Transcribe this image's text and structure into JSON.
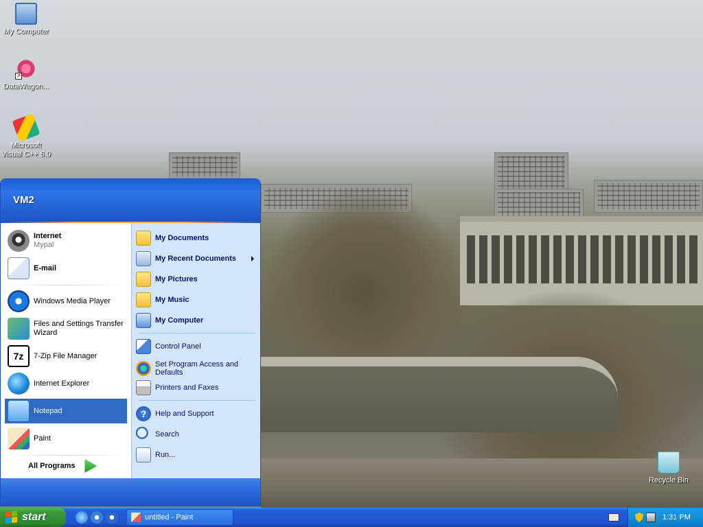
{
  "desktop": {
    "icons": [
      {
        "label": "My Computer"
      },
      {
        "label": "DataWagon..."
      },
      {
        "label": "Microsoft Visual C++ 6.0"
      },
      {
        "label": "Recycle Bin"
      }
    ]
  },
  "start_menu": {
    "user": "VM2",
    "pinned": [
      {
        "title": "Internet",
        "subtitle": "Mypal",
        "icon": "raccoon-icon"
      },
      {
        "title": "E-mail",
        "icon": "mail-icon"
      }
    ],
    "recent": [
      {
        "label": "Windows Media Player",
        "icon": "media-player-icon"
      },
      {
        "label": "Files and Settings Transfer Wizard",
        "icon": "transfer-wizard-icon"
      },
      {
        "label": "7-Zip File Manager",
        "icon": "7zip-icon"
      },
      {
        "label": "Internet Explorer",
        "icon": "internet-explorer-icon"
      },
      {
        "label": "Notepad",
        "icon": "notepad-icon",
        "highlighted": true
      },
      {
        "label": "Paint",
        "icon": "paint-icon"
      }
    ],
    "all_programs": "All Programs",
    "places": [
      {
        "label": "My Documents",
        "icon": "folder-icon"
      },
      {
        "label": "My Recent Documents",
        "icon": "recent-documents-icon",
        "submenu": true
      },
      {
        "label": "My Pictures",
        "icon": "folder-icon"
      },
      {
        "label": "My Music",
        "icon": "folder-icon"
      },
      {
        "label": "My Computer",
        "icon": "computer-icon"
      }
    ],
    "settings": [
      {
        "label": "Control Panel",
        "icon": "control-panel-icon"
      },
      {
        "label": "Set Program Access and Defaults",
        "icon": "program-defaults-icon"
      },
      {
        "label": "Printers and Faxes",
        "icon": "printer-icon"
      }
    ],
    "tools": [
      {
        "label": "Help and Support",
        "icon": "help-icon"
      },
      {
        "label": "Search",
        "icon": "search-icon"
      },
      {
        "label": "Run...",
        "icon": "run-icon"
      }
    ]
  },
  "taskbar": {
    "start_label": "start",
    "tasks": [
      {
        "label": "untitled - Paint",
        "icon": "paint-icon"
      }
    ],
    "clock": "1:31 PM"
  },
  "colors": {
    "start_header": "#1d5fd6",
    "start_right_pane": "#d3e5fa",
    "highlight": "#316ac5",
    "start_button": "#3c9a3c",
    "taskbar": "#245edb",
    "tray": "#1290db"
  }
}
